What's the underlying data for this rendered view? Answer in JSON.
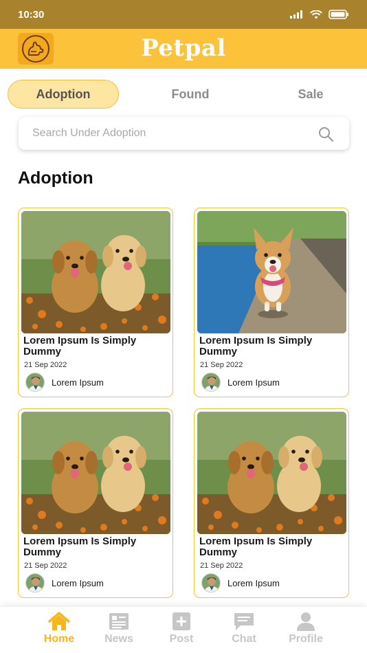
{
  "status_bar": {
    "time": "10:30"
  },
  "header": {
    "title": "Petpal"
  },
  "tabs": [
    {
      "label": "Adoption",
      "active": true
    },
    {
      "label": "Found",
      "active": false
    },
    {
      "label": "Sale",
      "active": false
    }
  ],
  "search": {
    "placeholder": "Search Under Adoption",
    "value": ""
  },
  "section": {
    "title": "Adoption"
  },
  "cards": [
    {
      "title": "Lorem Ipsum Is Simply Dummy",
      "date": "21 Sep 2022",
      "author": "Lorem Ipsum",
      "photo": "two-puppies"
    },
    {
      "title": "Lorem Ipsum Is Simply Dummy",
      "date": "21 Sep 2022",
      "author": "Lorem Ipsum",
      "photo": "corgi"
    },
    {
      "title": "Lorem Ipsum Is Simply Dummy",
      "date": "21 Sep 2022",
      "author": "Lorem Ipsum",
      "photo": "two-puppies"
    },
    {
      "title": "Lorem Ipsum Is Simply Dummy",
      "date": "21 Sep 2022",
      "author": "Lorem Ipsum",
      "photo": "two-puppies"
    }
  ],
  "bottom_nav": [
    {
      "label": "Home",
      "icon": "home-icon",
      "active": true
    },
    {
      "label": "News",
      "icon": "news-icon",
      "active": false
    },
    {
      "label": "Post",
      "icon": "post-icon",
      "active": false
    },
    {
      "label": "Chat",
      "icon": "chat-icon",
      "active": false
    },
    {
      "label": "Profile",
      "icon": "profile-icon",
      "active": false
    }
  ],
  "colors": {
    "accent": "#fcc33a",
    "status_bar": "#a8822c",
    "active_nav": "#f5b61e",
    "inactive_nav": "#c6c6c6",
    "card_border": "#f4c041"
  }
}
